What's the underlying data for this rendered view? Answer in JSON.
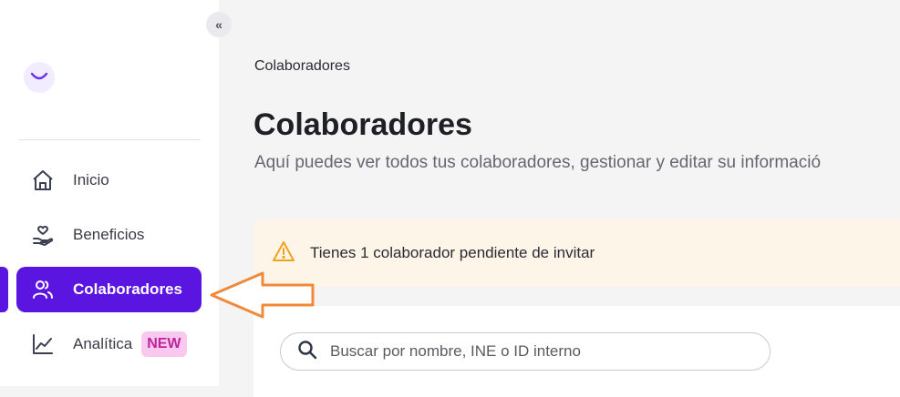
{
  "sidebar": {
    "collapse_label": "«",
    "items": [
      {
        "label": "Inicio",
        "icon": "home-icon"
      },
      {
        "label": "Beneficios",
        "icon": "hand-heart-icon"
      },
      {
        "label": "Colaboradores",
        "icon": "users-icon",
        "active": true
      },
      {
        "label": "Analítica",
        "icon": "chart-line-icon",
        "badge": "NEW"
      }
    ]
  },
  "main": {
    "breadcrumb": "Colaboradores",
    "title": "Colaboradores",
    "subtitle": "Aquí puedes ver todos tus colaboradores, gestionar y editar su informació",
    "alert": {
      "text": "Tienes 1 colaborador pendiente de invitar",
      "icon": "warning-icon"
    },
    "search": {
      "placeholder": "Buscar por nombre, INE o ID interno",
      "value": ""
    }
  },
  "colors": {
    "accent": "#5a16e0",
    "badge_bg": "#f8c8ef",
    "badge_text": "#c0249a",
    "alert_bg": "#fdf5e8",
    "warning": "#f0a21b",
    "annotation_arrow": "#f08a3a"
  }
}
